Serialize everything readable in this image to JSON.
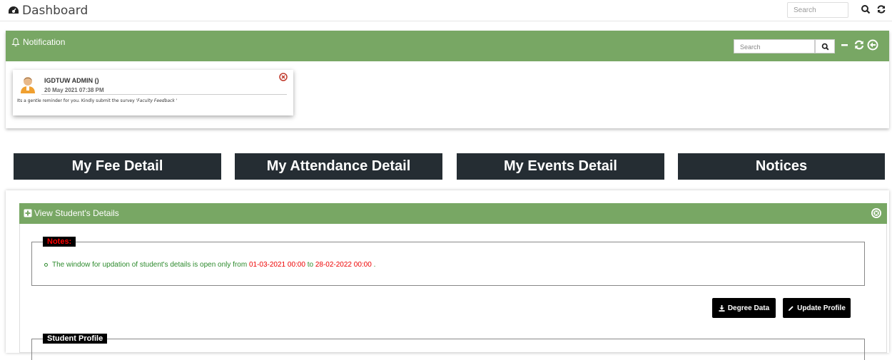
{
  "topbar": {
    "title": "Dashboard",
    "title_icon": "dashboard-icon",
    "search_placeholder": "Search",
    "icons": [
      "search-icon",
      "refresh-icon"
    ]
  },
  "notification_panel": {
    "title": "Notification",
    "title_icon": "bell-icon",
    "search_placeholder": "Search",
    "header_icons": [
      "search-icon",
      "minimize-icon",
      "refresh-icon",
      "back-icon"
    ],
    "card": {
      "sender": "IGDTUW ADMIN ()",
      "time": "20 May 2021 07:38 PM",
      "message_prefix": "Its a gentle reminder for you. Kindly submit the survey ",
      "message_survey": "'Faculty Feedback '",
      "close_icon": "close-circle-icon"
    }
  },
  "nav_buttons": [
    {
      "label": "My Fee Detail"
    },
    {
      "label": "My Attendance Detail"
    },
    {
      "label": "My Events Detail"
    },
    {
      "label": "Notices"
    }
  ],
  "details_panel": {
    "title": "View Student's Details",
    "title_icon": "plus-square-icon",
    "notes_legend": "Notes:",
    "note_prefix": "The window for updation of student's details is open only from ",
    "note_from": "01-03-2021 00:00",
    "note_to_word": " to ",
    "note_to": "28-02-2022 00:00",
    "note_suffix": " .",
    "degree_button": "Degree Data",
    "update_button": "Update Profile",
    "profile_legend": "Student Profile"
  },
  "colors": {
    "header_green": "#78a764",
    "button_dark": "#252d33",
    "note_green": "#2c8a2c",
    "note_red": "#e00000"
  }
}
